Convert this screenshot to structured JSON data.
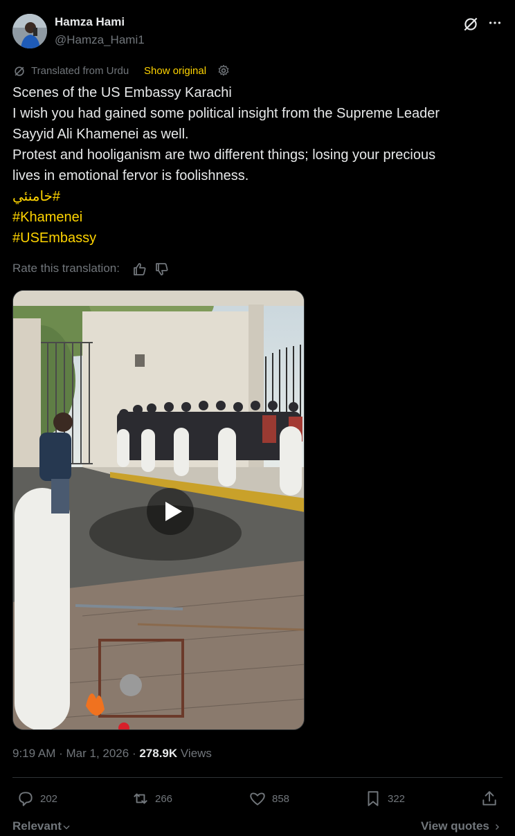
{
  "author": {
    "name": "Hamza Hami",
    "handle": "@Hamza_Hami1"
  },
  "translation": {
    "label": "Translated from Urdu",
    "show_original": "Show original"
  },
  "tweet": {
    "lines": [
      "Scenes of the US Embassy Karachi",
      "I wish you had gained some political insight from the Supreme Leader",
      "Sayyid Ali Khamenei as well.",
      "Protest and hooliganism are two different things; losing your precious",
      "lives in emotional fervor is foolishness."
    ],
    "hashtags": [
      "#خامنئي",
      "#Khamenei",
      "#USEmbassy"
    ]
  },
  "rate_translation": "Rate this translation:",
  "meta": {
    "time": "9:19 AM",
    "sep1": " · ",
    "date": "Mar 1, 2026",
    "sep2": " · ",
    "views_count": "278.9K",
    "views_label": " Views"
  },
  "actions": {
    "replies": "202",
    "reposts": "266",
    "likes": "858",
    "bookmarks": "322"
  },
  "footer": {
    "relevant": "Relevant",
    "view_quotes": "View quotes"
  },
  "colors": {
    "accent": "#ffd400",
    "muted": "#71767b",
    "text": "#e7e9ea",
    "background": "#000000"
  },
  "icons": [
    "grok-icon",
    "more-icon",
    "translate-icon",
    "gear-icon",
    "thumb-up-icon",
    "thumb-down-icon",
    "play-icon",
    "reply-icon",
    "repost-icon",
    "like-icon",
    "bookmark-icon",
    "share-icon",
    "chevron-down-icon",
    "chevron-right-icon"
  ]
}
